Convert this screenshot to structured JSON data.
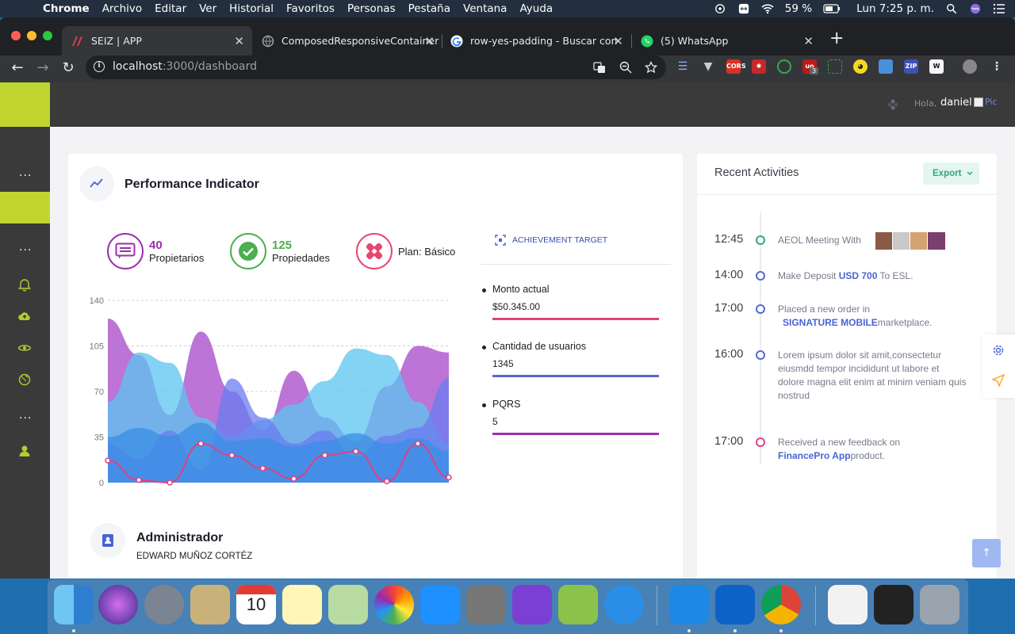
{
  "menubar": {
    "items": [
      "Chrome",
      "Archivo",
      "Editar",
      "Ver",
      "Historial",
      "Favoritos",
      "Personas",
      "Pestaña",
      "Ventana",
      "Ayuda"
    ],
    "battery": "59 %",
    "clock": "Lun 7:25 p. m."
  },
  "browser": {
    "tabs": [
      {
        "title": "SEIZ | APP"
      },
      {
        "title": "ComposedResponsiveContainer"
      },
      {
        "title": "row-yes-padding - Buscar con"
      },
      {
        "title": "(5) WhatsApp"
      }
    ],
    "url_host": "localhost",
    "url_path": ":3000/dashboard",
    "extension_badge": "3"
  },
  "header": {
    "greeting": "Hola,",
    "user": "daniel",
    "avatar_alt": "Pic"
  },
  "performance": {
    "title": "Performance Indicator",
    "stats": [
      {
        "value": "40",
        "label": "Propietarios",
        "color": "#9b2fae"
      },
      {
        "value": "125",
        "label": "Propiedades",
        "color": "#4caf50"
      },
      {
        "value": "",
        "label": "Plan: Básico",
        "color": "#e8466f"
      }
    ],
    "achievement_title": "ACHIEVEMENT TARGET",
    "metrics": [
      {
        "label": "Monto actual",
        "value": "$50.345.00",
        "color": "#e0407f"
      },
      {
        "label": "Cantidad de usuarios",
        "value": "1345",
        "color": "#5468d4"
      },
      {
        "label": "PQRS",
        "value": "5",
        "color": "#a02fb0"
      }
    ]
  },
  "chart_data": {
    "type": "area",
    "ylim": [
      0,
      140
    ],
    "yticks": [
      "0",
      "35",
      "70",
      "105",
      "140"
    ],
    "x": [
      0,
      1,
      2,
      3,
      4,
      5,
      6,
      7,
      8,
      9,
      10,
      11
    ],
    "series": [
      {
        "color": "#b05ccf",
        "values": [
          126,
          98,
          52,
          116,
          70,
          40,
          86,
          50,
          32,
          74,
          105,
          100
        ]
      },
      {
        "color": "#5cc4f0",
        "values": [
          62,
          100,
          92,
          50,
          36,
          48,
          60,
          78,
          103,
          98,
          62,
          30
        ]
      },
      {
        "color": "#6a7cf0",
        "values": [
          30,
          18,
          40,
          10,
          80,
          50,
          30,
          40,
          20,
          36,
          42,
          80
        ]
      },
      {
        "color": "#3a8fe6",
        "values": [
          35,
          42,
          36,
          46,
          32,
          34,
          28,
          32,
          38,
          30,
          34,
          24
        ]
      },
      {
        "color": "#e0407f",
        "values": [
          17,
          2,
          0,
          30,
          21,
          11,
          3,
          21,
          24,
          1,
          30,
          4
        ]
      }
    ]
  },
  "admin": {
    "title": "Administrador",
    "name": "EDWARD MUÑOZ CORTÉZ"
  },
  "activities": {
    "title": "Recent Activities",
    "export_label": "Export",
    "items": [
      {
        "time": "12:45",
        "text": "AEOL Meeting With",
        "color": "#2eaa7a"
      },
      {
        "time": "14:00",
        "pre": "Make Deposit ",
        "hl": "USD 700",
        "post": " To ESL.",
        "color": "#5468d4"
      },
      {
        "time": "17:00",
        "pre": "Placed a new order in",
        "hl": "SIGNATURE MOBILE",
        "post": "marketplace.",
        "color": "#5468d4"
      },
      {
        "time": "16:00",
        "text": "Lorem ipsum dolor sit amit,consectetur eiusmdd tempor incididunt ut labore et dolore magna elit enim at minim veniam quis nostrud",
        "color": "#5468d4"
      },
      {
        "time": "17:00",
        "pre": "Received a new feedback on",
        "hl": "FinancePro App",
        "post": "product.",
        "color": "#e0407f"
      }
    ]
  }
}
